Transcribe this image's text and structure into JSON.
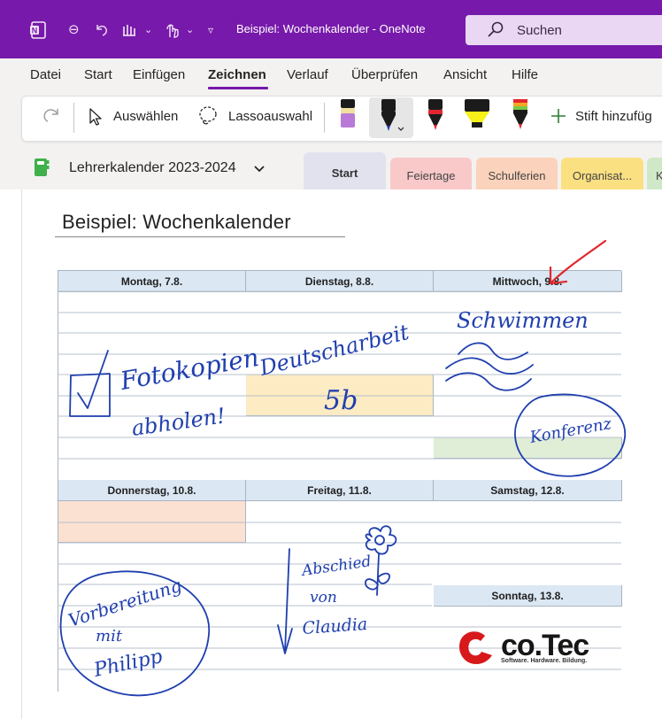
{
  "titlebar": {
    "title": "Beispiel: Wochenkalender  -  OneNote",
    "search_label": "Suchen"
  },
  "menu": {
    "items": [
      "Datei",
      "Start",
      "Einfügen",
      "Zeichnen",
      "Verlauf",
      "Überprüfen",
      "Ansicht",
      "Hilfe"
    ],
    "active": "Zeichnen"
  },
  "toolbar": {
    "select_label": "Auswählen",
    "lasso_label": "Lassoauswahl",
    "add_pen_label": "Stift hinzufüg"
  },
  "notebook": {
    "name": "Lehrerkalender 2023-2024"
  },
  "tabs": [
    {
      "label": "Start",
      "color": "#e2e2ee"
    },
    {
      "label": "Feiertage",
      "color": "#f9c9ca"
    },
    {
      "label": "Schulferien",
      "color": "#fbd2bb"
    },
    {
      "label": "Organisat...",
      "color": "#fbe082"
    },
    {
      "label": "K",
      "color": "#cfe8c8"
    }
  ],
  "page": {
    "title": "Beispiel: Wochenkalender"
  },
  "calendar": {
    "days": [
      "Montag, 7.8.",
      "Dienstag, 8.8.",
      "Mittwoch, 9.8.",
      "Donnerstag, 10.8.",
      "Freitag, 11.8.",
      "Samstag, 12.8.",
      "Sonntag, 13.8."
    ],
    "header_color": "#dbe7f3",
    "highlight_yellow": "#fcebc3",
    "highlight_green": "#e0edd7",
    "highlight_orange": "#fbe1d1"
  },
  "ink": {
    "montag": [
      "Fotokopien",
      "abholen!"
    ],
    "dienstag": [
      "Deutscharbeit",
      "5b"
    ],
    "mittwoch": [
      "Schwimmen",
      "Konferenz"
    ],
    "donnerstag": [
      "Vorbereitung",
      "mit",
      "Philipp"
    ],
    "freitag": [
      "Abschied",
      "von",
      "Claudia"
    ],
    "color": "#1f3fae",
    "arrow_color": "#e3262d"
  },
  "logo": {
    "name": "co.Tec",
    "tagline": "Software. Hardware. Bildung.",
    "color": "#d7191b"
  }
}
